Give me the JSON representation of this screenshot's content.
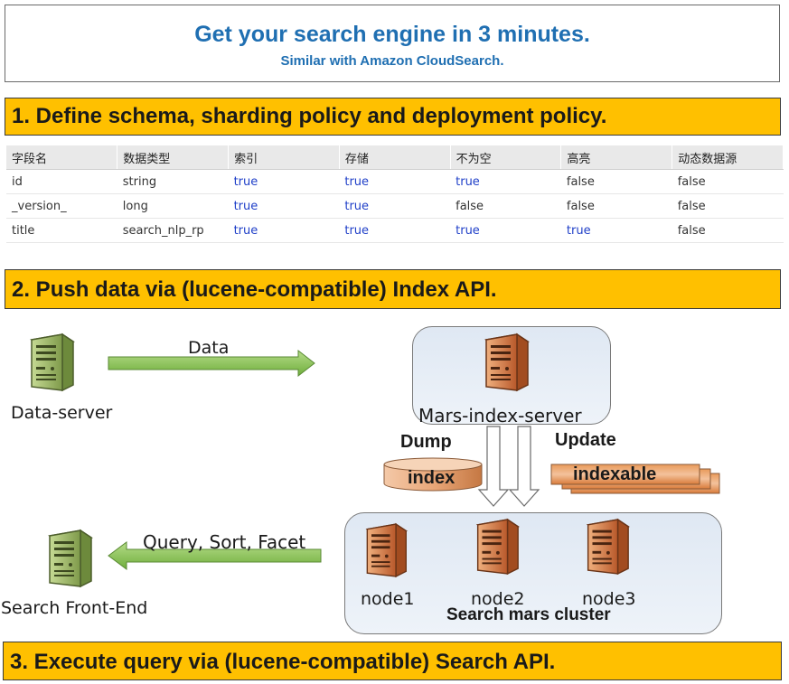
{
  "header": {
    "title": "Get your search engine in 3 minutes.",
    "subtitle": "Similar with Amazon CloudSearch."
  },
  "steps": [
    {
      "label": "1. Define schema, sharding policy and deployment policy."
    },
    {
      "label": "2. Push data via (lucene-compatible) Index API."
    },
    {
      "label": "3. Execute query via (lucene-compatible) Search API."
    }
  ],
  "schema_table": {
    "headers": [
      "字段名",
      "数据类型",
      "索引",
      "存储",
      "不为空",
      "高亮",
      "动态数据源"
    ],
    "rows": [
      [
        "id",
        "string",
        "true",
        "true",
        "true",
        "false",
        "false"
      ],
      [
        "_version_",
        "long",
        "true",
        "true",
        "false",
        "false",
        "false"
      ],
      [
        "title",
        "search_nlp_rp",
        "true",
        "true",
        "true",
        "true",
        "false"
      ]
    ]
  },
  "diagram": {
    "data_server_label": "Data-server",
    "data_arrow_label": "Data",
    "index_server_label": "Mars-index-server",
    "dump_label": "Dump",
    "update_label": "Update",
    "index_db_label": "index",
    "indexable_label": "indexable",
    "query_arrow_label": "Query, Sort, Facet",
    "frontend_label": "Search Front-End",
    "nodes": [
      "node1",
      "node2",
      "node3"
    ],
    "cluster_label": "Search mars cluster"
  },
  "colors": {
    "accent_blue": "#1f6fb2",
    "step_bar": "#ffc000",
    "true_value": "#1f3fc8",
    "arrow_green": "#8cc152",
    "server_green": "#9bb56a",
    "server_orange": "#d87a3c"
  }
}
